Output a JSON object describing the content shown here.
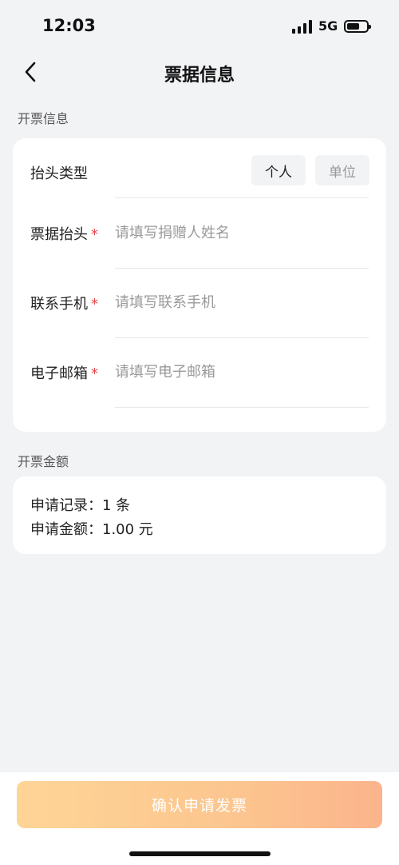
{
  "status_bar": {
    "time": "12:03",
    "network": "5G",
    "battery_level": 0.65
  },
  "nav": {
    "title": "票据信息"
  },
  "invoice_section": {
    "label": "开票信息",
    "header_type": {
      "label": "抬头类型",
      "options": [
        "个人",
        "单位"
      ],
      "selected": "个人"
    },
    "fields": [
      {
        "label": "票据抬头",
        "required": "*",
        "placeholder": "请填写捐赠人姓名",
        "value": ""
      },
      {
        "label": "联系手机",
        "required": "*",
        "placeholder": "请填写联系手机",
        "value": ""
      },
      {
        "label": "电子邮箱",
        "required": "*",
        "placeholder": "请填写电子邮箱",
        "value": ""
      }
    ]
  },
  "amount_section": {
    "label": "开票金额",
    "records_line": "申请记录：1 条",
    "amount_line": "申请金额：1.00 元"
  },
  "footer": {
    "submit_label": "确认申请发票"
  },
  "colors": {
    "required": "#e5484d",
    "button_start": "#fed596",
    "button_end": "#fbb48c",
    "background": "#f2f3f5"
  }
}
